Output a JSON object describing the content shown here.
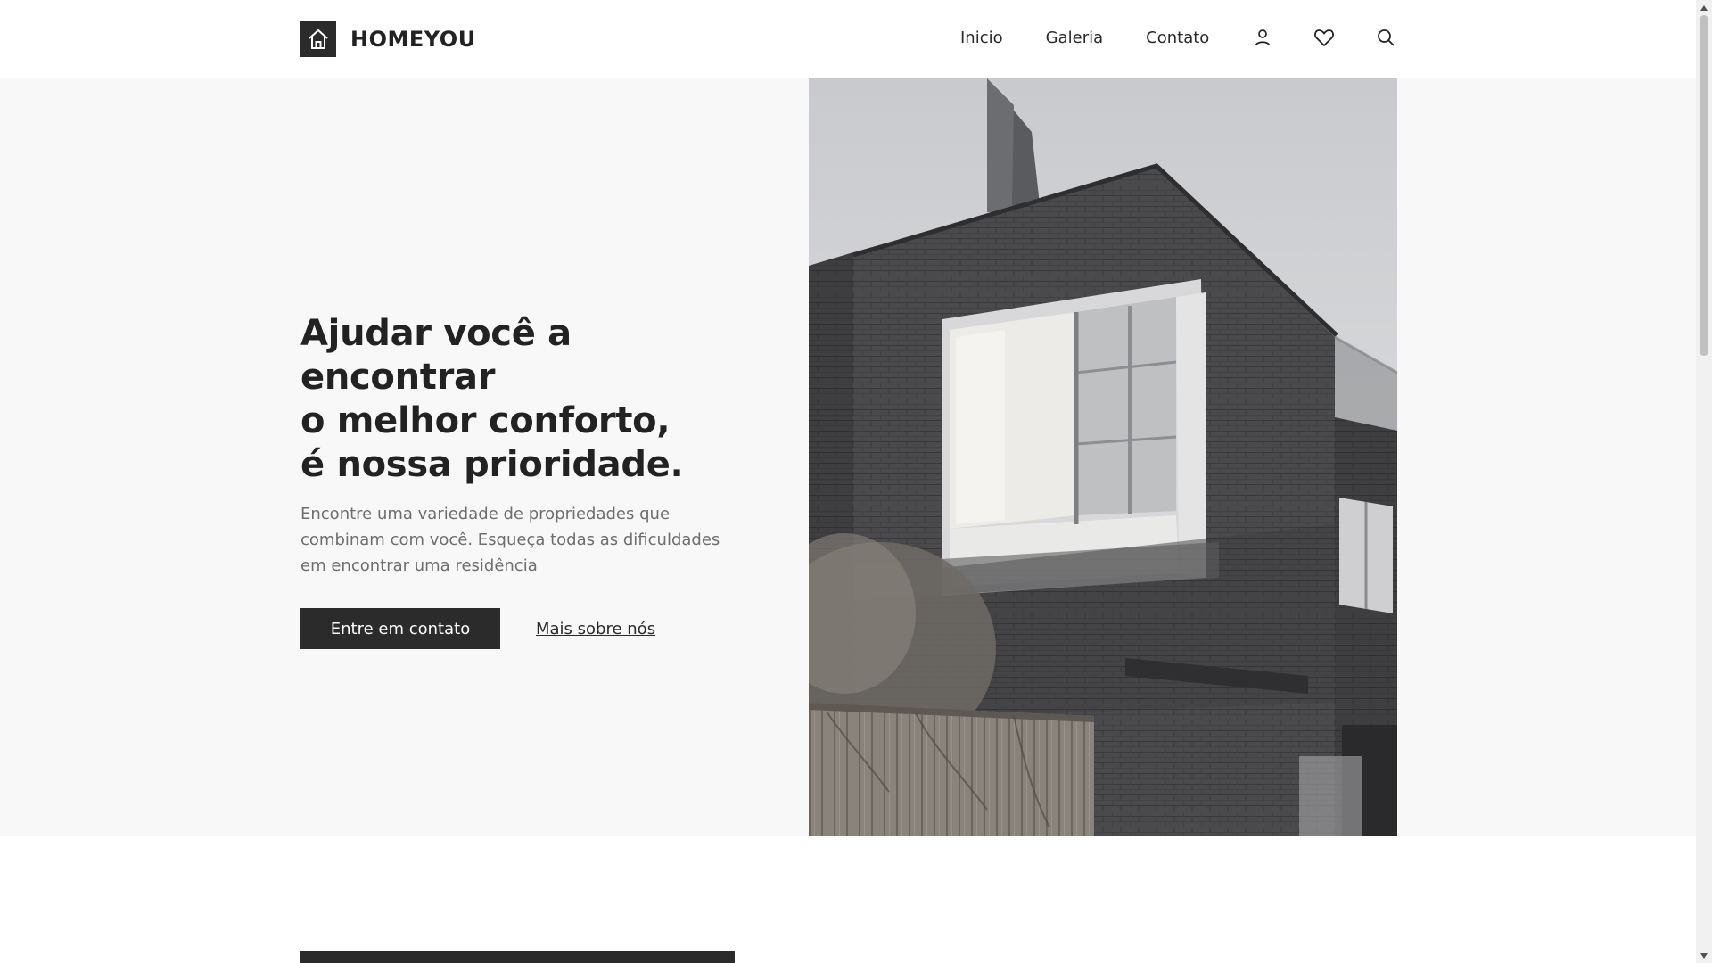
{
  "brand": {
    "name": "HOMEYOU",
    "logo_icon": "house-icon"
  },
  "nav": {
    "links": [
      "Inicio",
      "Galeria",
      "Contato"
    ],
    "icons": [
      "user-icon",
      "heart-icon",
      "search-icon"
    ]
  },
  "hero": {
    "title": "Ajudar você a encontrar\no melhor conforto,\né nossa prioridade.",
    "description": "Encontre uma variedade de propriedades que combinam com você. Esqueça todas as dificuldades em encontrar uma residência",
    "primary_button": "Entre em contato",
    "secondary_link": "Mais sobre nós"
  },
  "colors": {
    "accent": "#2b2b2b",
    "hero_background": "#f8f8f8",
    "text_muted": "#6e6e6e"
  }
}
